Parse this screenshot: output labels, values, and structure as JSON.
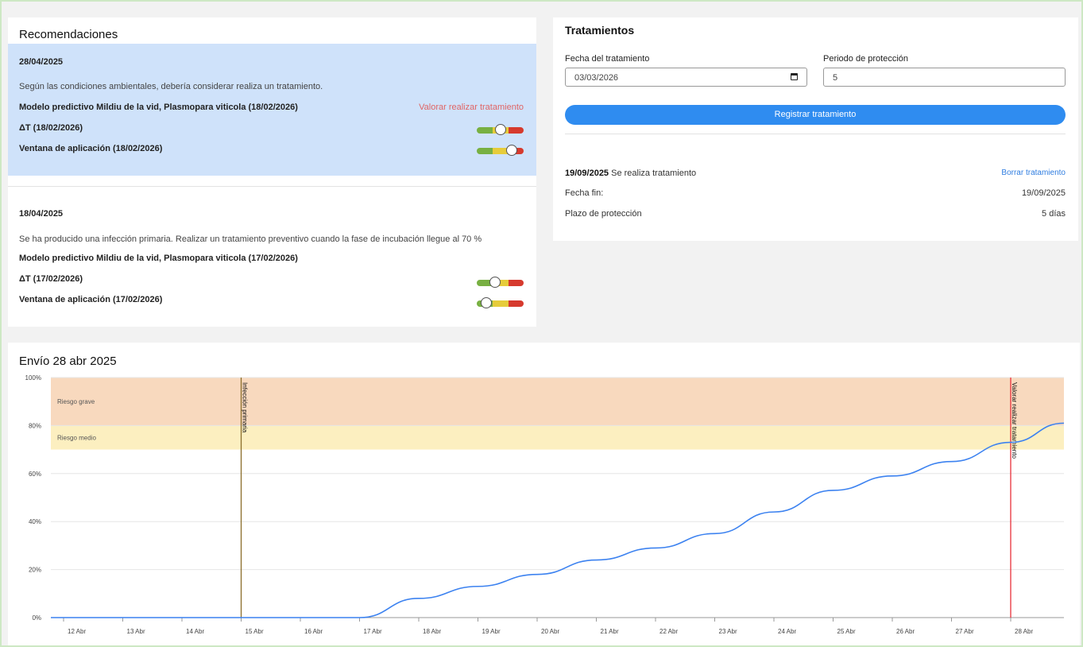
{
  "recommendations": {
    "title": "Recomendaciones",
    "cards": [
      {
        "date": "28/04/2025",
        "description": "Según las condiciones ambientales, debería considerar realiza un tratamiento.",
        "model": "Modelo predictivo Mildiu de la vid, Plasmopara viticola (18/02/2026)",
        "action": "Valorar realizar tratamiento",
        "delta_label": "ΔT (18/02/2026)",
        "delta_gauge_level": 0.5,
        "window_label": "Ventana de aplicación (18/02/2026)",
        "window_gauge_level": 0.83
      },
      {
        "date": "18/04/2025",
        "description": "Se ha producido una infección primaria. Realizar un tratamiento preventivo cuando la fase de incubación llegue al 70 %",
        "model": "Modelo predictivo Mildiu de la vid, Plasmopara viticola (17/02/2026)",
        "action": "",
        "delta_label": "ΔT (17/02/2026)",
        "delta_gauge_level": 0.35,
        "window_label": "Ventana de aplicación (17/02/2026)",
        "window_gauge_level": 0.1
      }
    ],
    "gauge_colors": {
      "green": "#78b042",
      "yellow": "#e6cc3b",
      "red": "#d63a2e"
    }
  },
  "treatments": {
    "title": "Tratamientos",
    "date_label": "Fecha del tratamiento",
    "date_value": "03/03/2026",
    "period_label": "Periodo de protección",
    "period_value": "5",
    "register_button": "Registrar tratamiento",
    "record": {
      "date": "19/09/2025",
      "text": "Se realiza tratamiento",
      "delete_link": "Borrar tratamiento",
      "end_label": "Fecha fin:",
      "end_value": "19/09/2025",
      "term_label": "Plazo de protección",
      "term_value": "5 días"
    }
  },
  "chart_data": {
    "type": "line",
    "title": "Envío 28 abr 2025",
    "xlabel": "",
    "ylabel": "",
    "ylim": [
      0,
      100
    ],
    "yticks": [
      "0%",
      "20%",
      "40%",
      "60%",
      "80%",
      "100%"
    ],
    "x_ticks": [
      "12 Abr",
      "13 Abr",
      "14 Abr",
      "15 Abr",
      "16 Abr",
      "17 Abr",
      "18 Abr",
      "19 Abr",
      "20 Abr",
      "21 Abr",
      "22 Abr",
      "23 Abr",
      "24 Abr",
      "25 Abr",
      "26 Abr",
      "27 Abr",
      "28 Abr"
    ],
    "x": [
      "12 Abr",
      "13 Abr",
      "14 Abr",
      "15 Abr",
      "16 Abr",
      "17 Abr",
      "18 Abr",
      "19 Abr",
      "20 Abr",
      "21 Abr",
      "22 Abr",
      "23 Abr",
      "24 Abr",
      "25 Abr",
      "26 Abr",
      "27 Abr",
      "28 Abr"
    ],
    "series": [
      {
        "values": [
          0,
          0,
          0,
          0,
          0,
          0,
          8,
          13,
          18,
          24,
          29,
          35,
          44,
          53,
          59,
          65,
          73
        ]
      }
    ],
    "series_end_value": 81,
    "line_color": "#3c82f0",
    "bands": [
      {
        "label": "Riesgo grave",
        "from": 80,
        "to": 100,
        "color": "#f8d9be"
      },
      {
        "label": "Riesgo medio",
        "from": 70,
        "to": 80,
        "color": "#fcefc0"
      }
    ],
    "markers": [
      {
        "label": "Infección primaria",
        "x": "15 Abr",
        "color": "#8a6d2a"
      },
      {
        "label": "Valorar realizar tratamiento",
        "x": "28 Abr",
        "color": "#e8303a"
      }
    ],
    "grid": true
  }
}
